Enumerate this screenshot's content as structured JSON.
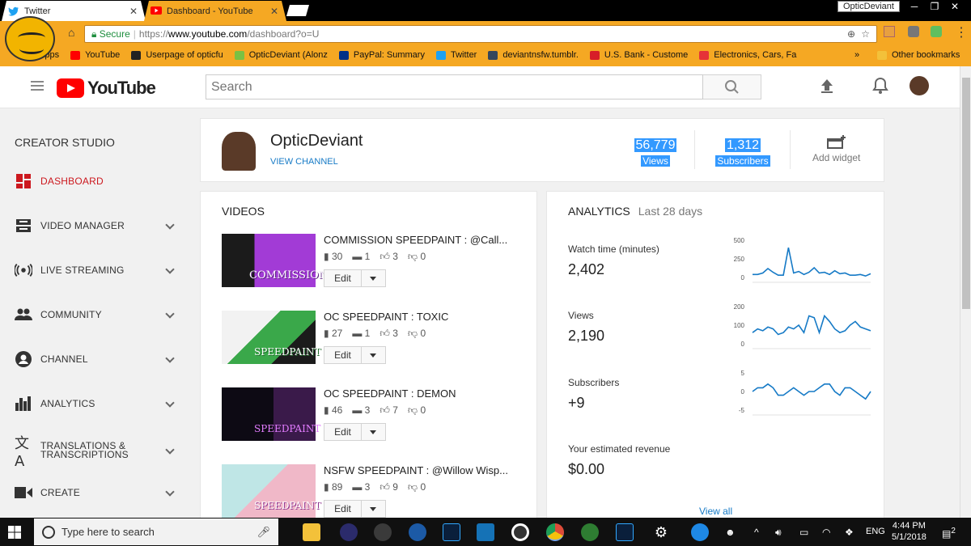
{
  "browser": {
    "tabs": [
      {
        "title": "Twitter",
        "active": false
      },
      {
        "title": "Dashboard - YouTube",
        "active": true
      }
    ],
    "profile_name": "OpticDeviant",
    "omnibox": {
      "secure_label": "Secure",
      "scheme": "https://",
      "host": "www.youtube.com",
      "path": "/dashboard?o=U"
    },
    "bookmarks": [
      {
        "label": "Apps",
        "color": "#4285f4"
      },
      {
        "label": "YouTube",
        "color": "#ff0000"
      },
      {
        "label": "Userpage of opticfu",
        "color": "#222222"
      },
      {
        "label": "OpticDeviant (Alonz",
        "color": "#7ac143"
      },
      {
        "label": "PayPal: Summary",
        "color": "#003087"
      },
      {
        "label": "Twitter",
        "color": "#1da1f2"
      },
      {
        "label": "deviantnsfw.tumblr.",
        "color": "#35465c"
      },
      {
        "label": "U.S. Bank - Custome",
        "color": "#d71e28"
      },
      {
        "label": "Electronics, Cars, Fa",
        "color": "#e53238"
      }
    ],
    "bookmarks_overflow": "»",
    "other_bookmarks": "Other bookmarks"
  },
  "youtube": {
    "logo_text": "YouTube",
    "search_placeholder": "Search"
  },
  "sidebar": {
    "title": "CREATOR STUDIO",
    "items": [
      {
        "label": "DASHBOARD",
        "active": true,
        "icon": "dashboard-icon"
      },
      {
        "label": "VIDEO MANAGER",
        "icon": "video-manager-icon"
      },
      {
        "label": "LIVE STREAMING",
        "icon": "live-streaming-icon"
      },
      {
        "label": "COMMUNITY",
        "icon": "community-icon"
      },
      {
        "label": "CHANNEL",
        "icon": "channel-icon"
      },
      {
        "label": "ANALYTICS",
        "icon": "analytics-icon"
      },
      {
        "label": "TRANSLATIONS &",
        "label2": "TRANSCRIPTIONS",
        "icon": "translations-icon"
      },
      {
        "label": "CREATE",
        "icon": "create-icon"
      }
    ]
  },
  "channel": {
    "name": "OpticDeviant",
    "view_channel": "VIEW CHANNEL",
    "views": "56,779",
    "views_label": "Views",
    "subscribers": "1,312",
    "subscribers_label": "Subscribers",
    "add_widget": "Add widget"
  },
  "videos": {
    "title": "VIDEOS",
    "edit_label": "Edit",
    "items": [
      {
        "title": "COMMISSION SPEEDPAINT : @Call...",
        "views": "30",
        "comments": "1",
        "likes": "3",
        "dislikes": "0",
        "thumb_text": "COMMISSION"
      },
      {
        "title": "OC SPEEDPAINT : TOXIC",
        "views": "27",
        "comments": "1",
        "likes": "3",
        "dislikes": "0",
        "thumb_text": "SPEEDPAINT"
      },
      {
        "title": "OC SPEEDPAINT : DEMON",
        "views": "46",
        "comments": "3",
        "likes": "7",
        "dislikes": "0",
        "thumb_text": "SPEEDPAINT"
      },
      {
        "title": "NSFW SPEEDPAINT : @Willow Wisp...",
        "views": "89",
        "comments": "3",
        "likes": "9",
        "dislikes": "0",
        "thumb_text": "SPEEDPAINT"
      }
    ]
  },
  "analytics": {
    "title": "ANALYTICS",
    "period": "Last 28 days",
    "metrics": [
      {
        "label": "Watch time (minutes)",
        "value": "2,402",
        "ticks": [
          "500",
          "250",
          "0"
        ]
      },
      {
        "label": "Views",
        "value": "2,190",
        "ticks": [
          "200",
          "100",
          "0"
        ]
      },
      {
        "label": "Subscribers",
        "value": "+9",
        "ticks": [
          "5",
          "0",
          "-5"
        ]
      },
      {
        "label": "Your estimated revenue",
        "value": "$0.00"
      }
    ],
    "view_all": "View all"
  },
  "chart_data": [
    {
      "type": "line",
      "ylim": [
        0,
        500
      ],
      "series": [
        {
          "values": [
            40,
            40,
            60,
            120,
            70,
            30,
            30,
            400,
            60,
            80,
            40,
            70,
            130,
            60,
            70,
            40,
            90,
            50,
            60,
            30,
            30,
            40,
            20,
            50
          ]
        }
      ]
    },
    {
      "type": "line",
      "ylim": [
        0,
        200
      ],
      "series": [
        {
          "values": [
            60,
            80,
            70,
            90,
            80,
            50,
            60,
            90,
            80,
            100,
            60,
            150,
            140,
            60,
            150,
            120,
            80,
            60,
            70,
            100,
            120,
            90,
            80,
            70
          ]
        }
      ]
    },
    {
      "type": "line",
      "ylim": [
        -5,
        5
      ],
      "series": [
        {
          "values": [
            0,
            1,
            1,
            2,
            1,
            -1,
            -1,
            0,
            1,
            0,
            -1,
            0,
            0,
            1,
            2,
            2,
            0,
            -1,
            1,
            1,
            0,
            -1,
            -2,
            0
          ]
        }
      ]
    }
  ],
  "taskbar": {
    "search_placeholder": "Type here to search",
    "language": "ENG",
    "time": "4:44 PM",
    "date": "5/1/2018",
    "notification_count": "2",
    "apps": [
      {
        "name": "file-explorer-icon",
        "color": "#f3c13a"
      },
      {
        "name": "app-icon-2",
        "color": "#2b2b6b"
      },
      {
        "name": "obs-icon",
        "color": "#3a3a3a"
      },
      {
        "name": "app-icon-4",
        "color": "#1c5aa6"
      },
      {
        "name": "photoshop-icon",
        "color": "#0a1f3b"
      },
      {
        "name": "app-icon-6",
        "color": "#1572b6"
      },
      {
        "name": "app-icon-7",
        "color": "#333333"
      },
      {
        "name": "chrome-icon",
        "color": "#dd4b39"
      },
      {
        "name": "app-icon-9",
        "color": "#2e7d32"
      },
      {
        "name": "photoshop-icon-2",
        "color": "#0a1f3b"
      },
      {
        "name": "settings-icon",
        "color": "#444444"
      },
      {
        "name": "help-icon",
        "color": "#1e88e5"
      }
    ]
  }
}
